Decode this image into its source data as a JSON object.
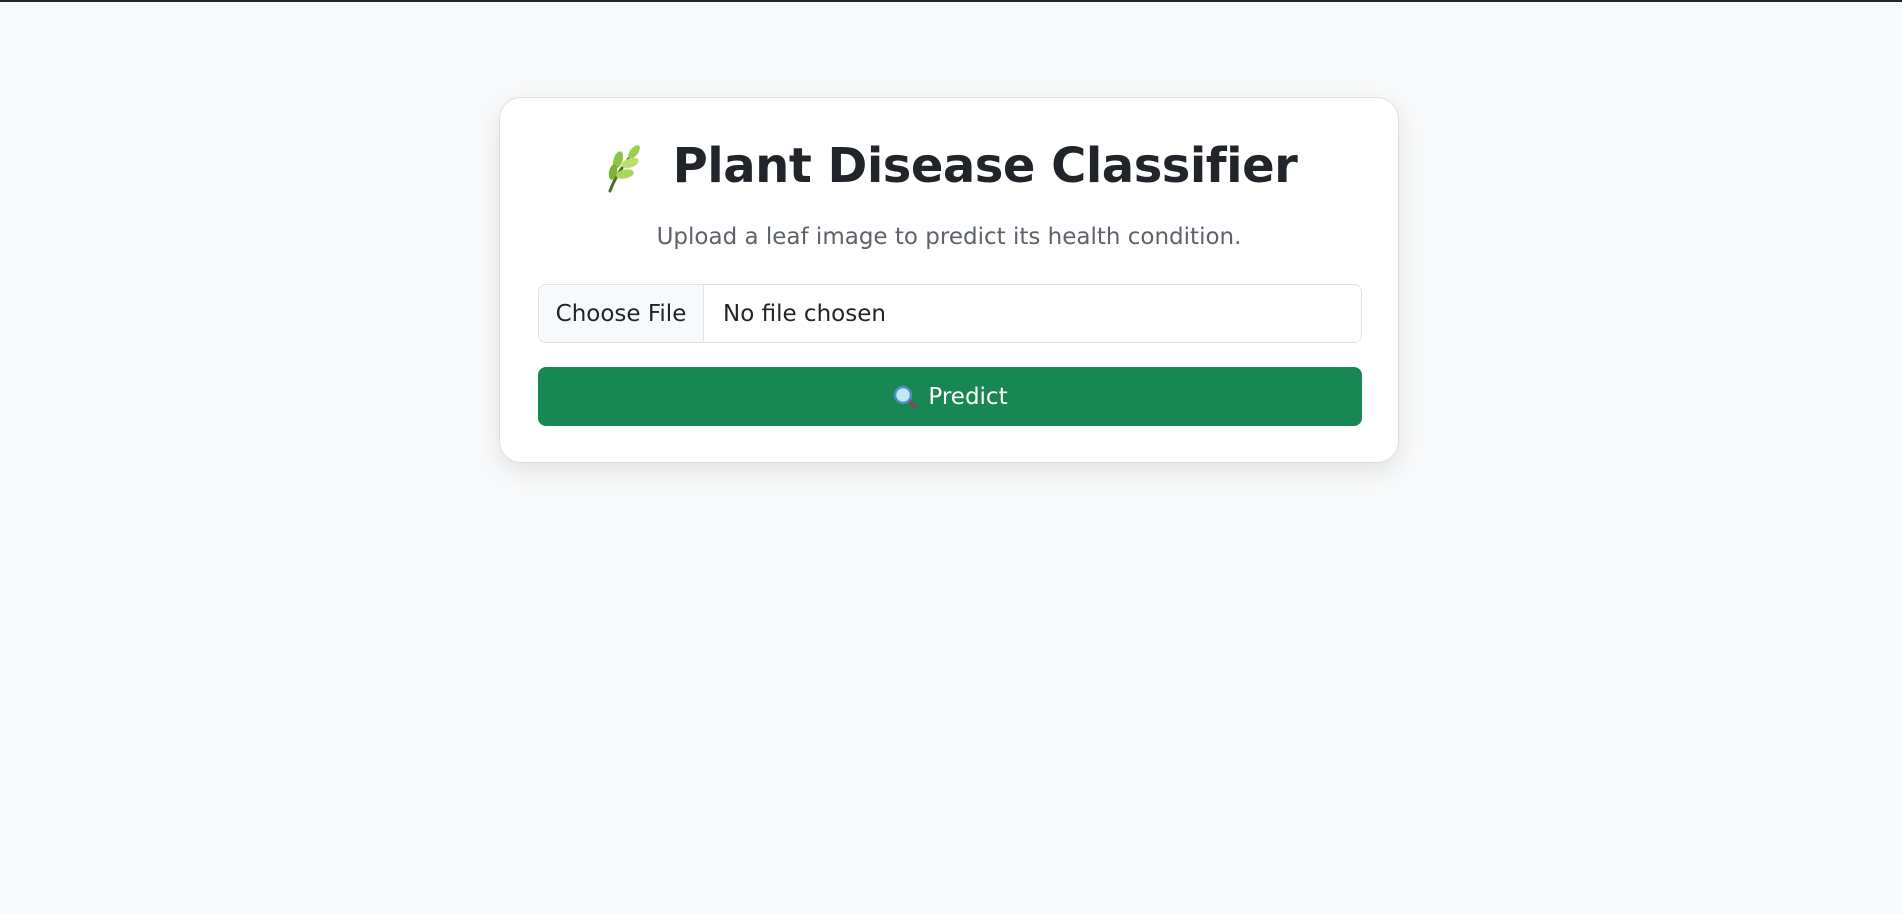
{
  "header": {
    "icon": "leaf-icon",
    "title": "Plant Disease Classifier",
    "subtitle": "Upload a leaf image to predict its health condition."
  },
  "upload": {
    "button_label": "Choose File",
    "status": "No file chosen"
  },
  "predict": {
    "icon": "magnifying-glass-icon",
    "label": "Predict"
  },
  "colors": {
    "background": "#f8f9fa",
    "card": "#ffffff",
    "accent": "#198754",
    "text": "#212529",
    "muted_text": "#5c636a"
  }
}
